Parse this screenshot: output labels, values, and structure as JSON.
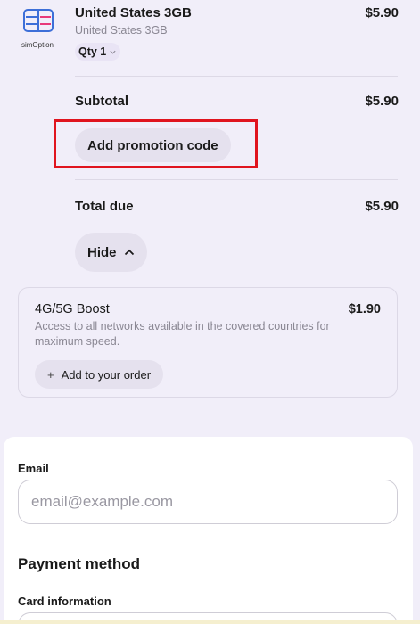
{
  "product": {
    "logo_text": "simOption",
    "name": "United States 3GB",
    "subtitle": "United States 3GB",
    "price": "$5.90",
    "qty_label": "Qty 1"
  },
  "summary": {
    "subtotal_label": "Subtotal",
    "subtotal_value": "$5.90",
    "promo_label": "Add promotion code",
    "total_label": "Total due",
    "total_value": "$5.90",
    "hide_label": "Hide"
  },
  "addon": {
    "title": "4G/5G Boost",
    "price": "$1.90",
    "description": "Access to all networks available in the covered countries for maximum speed.",
    "button_label": "Add to your order"
  },
  "payment": {
    "email_label": "Email",
    "email_placeholder": "email@example.com",
    "email_value": "",
    "heading": "Payment method",
    "card_label": "Card information"
  },
  "colors": {
    "background": "#f1eef9",
    "button_bg": "#e5e1ee",
    "highlight": "#e0141e",
    "logo_blue": "#3d6fd8",
    "logo_pink": "#e8397a"
  }
}
